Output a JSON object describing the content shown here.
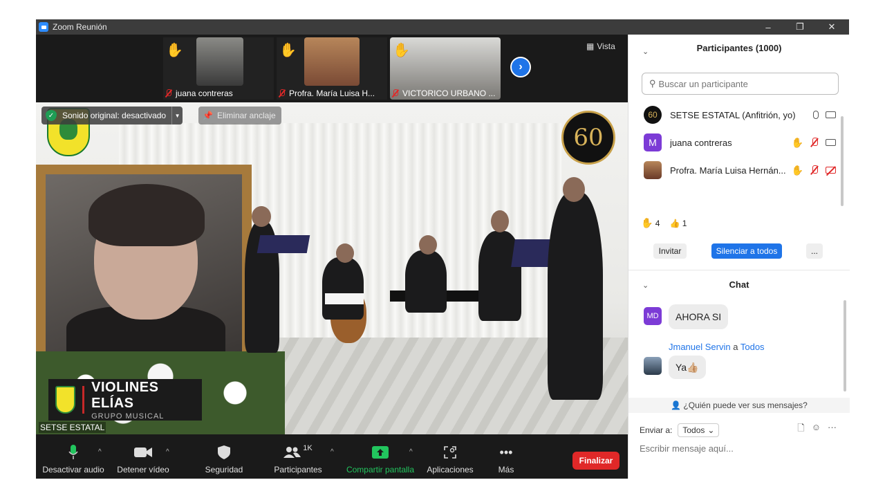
{
  "window": {
    "title": "Zoom Reunión",
    "controls": [
      "–",
      "❐",
      "✕"
    ]
  },
  "thumbnails": [
    {
      "name": "juana contreras",
      "hand_raised": true,
      "muted": true
    },
    {
      "name": "Profra. María Luisa H...",
      "hand_raised": true,
      "muted": true
    },
    {
      "name": "VICTORICO URBANO ...",
      "hand_raised": true,
      "muted": true
    }
  ],
  "view_button": "Vista",
  "main_video": {
    "original_sound": "Sonido original: desactivado",
    "unpin": "Eliminar anclaje",
    "anniversary_logo": "60",
    "lower_third_title": "VIOLINES ELÍAS",
    "lower_third_subtitle": "GRUPO MUSICAL",
    "speaker_name": "SETSE ESTATAL"
  },
  "toolbar": {
    "audio": "Desactivar audio",
    "video": "Detener vídeo",
    "security": "Seguridad",
    "participants": "Participantes",
    "participants_count": "1K",
    "share": "Compartir pantalla",
    "apps": "Aplicaciones",
    "more": "Más",
    "end": "Finalizar"
  },
  "participants_panel": {
    "title": "Participantes (1000)",
    "search_placeholder": "Buscar un participante",
    "rows": [
      {
        "avatar": "60",
        "name": "SETSE ESTATAL (Anfitrión, yo)"
      },
      {
        "avatar": "M",
        "name": "juana contreras"
      },
      {
        "avatar": "",
        "name": "Profra. María Luisa Hernán..."
      }
    ],
    "reaction_hand_count": "4",
    "reaction_thumb_count": "1",
    "invite": "Invitar",
    "mute_all": "Silenciar a todos",
    "more": "..."
  },
  "chat": {
    "title": "Chat",
    "messages": [
      {
        "avatar": "MD",
        "text": "AHORA SI"
      },
      {
        "sender": "Jmanuel Servin",
        "to_word": "a",
        "recipient": "Todos",
        "text": "Ya👍🏼"
      }
    ],
    "who_can_see": "¿Quién puede ver sus mensajes?",
    "send_to_label": "Enviar a:",
    "send_to_value": "Todos",
    "compose_placeholder": "Escribir mensaje aquí..."
  },
  "colors": {
    "accent": "#1f74e8",
    "end": "#e02828",
    "share": "#22c55e",
    "raise_hand": "#f0a800"
  }
}
